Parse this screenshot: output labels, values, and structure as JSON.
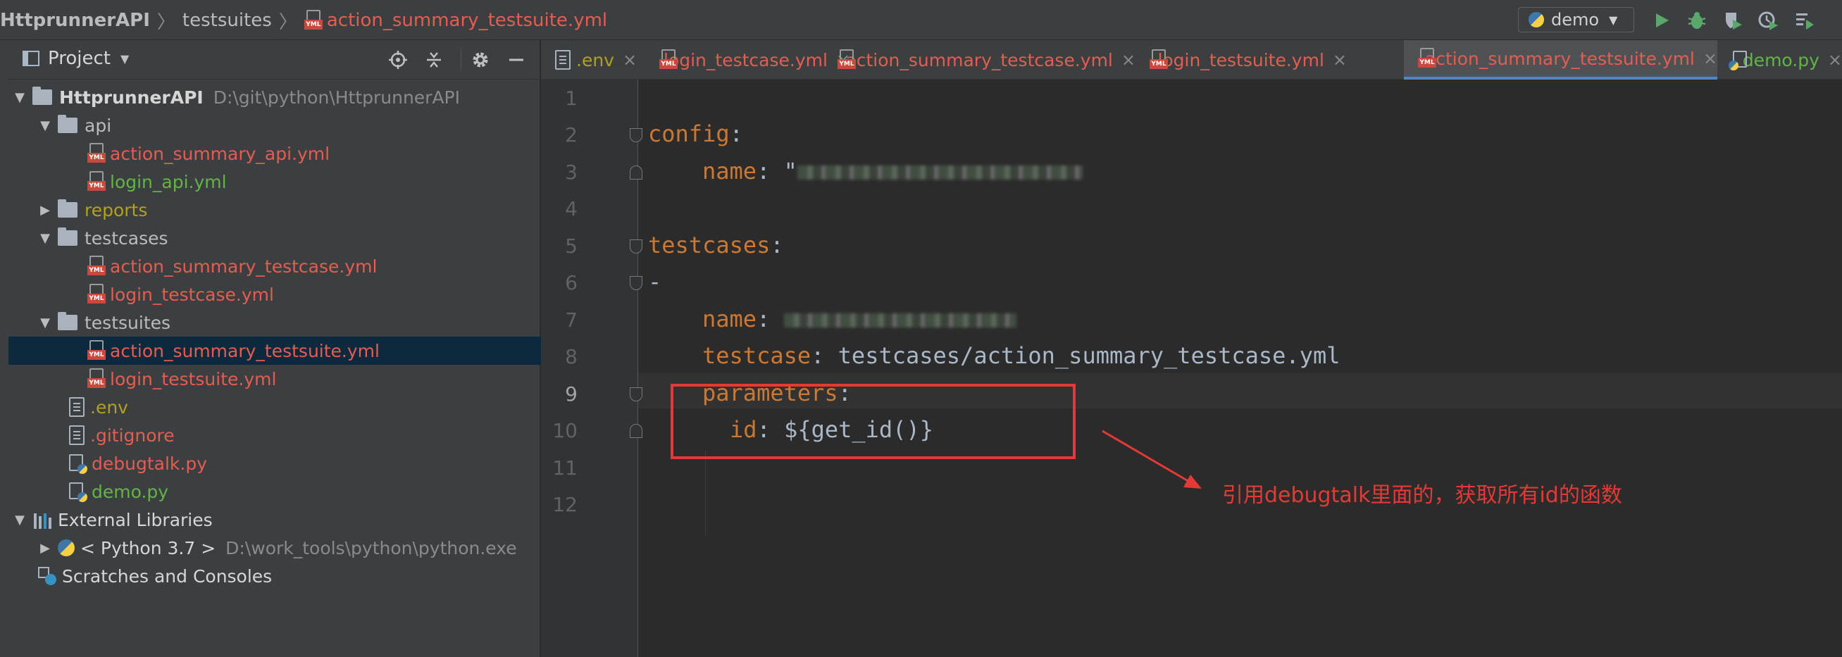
{
  "breadcrumb": {
    "project": "HttprunnerAPI",
    "folder": "testsuites",
    "file": "action_summary_testsuite.yml"
  },
  "toolbar": {
    "run_config": "demo",
    "icons": [
      "run-icon",
      "debug-icon",
      "coverage-icon",
      "profile-icon",
      "run-menu-icon"
    ]
  },
  "project_panel": {
    "title": "Project",
    "header_icons": [
      "locate-icon",
      "collapse-all-icon",
      "settings-icon",
      "hide-icon"
    ],
    "tree": [
      {
        "label": "HttprunnerAPI",
        "path": "D:\\git\\python\\HttprunnerAPI",
        "type": "root",
        "expanded": true
      },
      {
        "label": "api",
        "type": "folder",
        "expanded": true
      },
      {
        "label": "action_summary_api.yml",
        "type": "yml"
      },
      {
        "label": "login_api.yml",
        "type": "yml"
      },
      {
        "label": "reports",
        "type": "folder",
        "expanded": false
      },
      {
        "label": "testcases",
        "type": "folder",
        "expanded": true
      },
      {
        "label": "action_summary_testcase.yml",
        "type": "yml"
      },
      {
        "label": "login_testcase.yml",
        "type": "yml"
      },
      {
        "label": "testsuites",
        "type": "folder",
        "expanded": true
      },
      {
        "label": "action_summary_testsuite.yml",
        "type": "yml",
        "selected": true
      },
      {
        "label": "login_testsuite.yml",
        "type": "yml"
      },
      {
        "label": ".env",
        "type": "file"
      },
      {
        "label": ".gitignore",
        "type": "file"
      },
      {
        "label": "debugtalk.py",
        "type": "py"
      },
      {
        "label": "demo.py",
        "type": "py"
      },
      {
        "label": "External Libraries",
        "type": "lib",
        "expanded": true
      },
      {
        "label": "< Python 3.7 >",
        "path": "D:\\work_tools\\python\\python.exe",
        "type": "sdk"
      },
      {
        "label": "Scratches and Consoles",
        "type": "scratch"
      }
    ]
  },
  "tabs": [
    {
      "label": ".env",
      "close": "×"
    },
    {
      "label": "login_testcase.yml",
      "close": "×"
    },
    {
      "label": "action_summary_testcase.yml",
      "close": "×"
    },
    {
      "label": "login_testsuite.yml",
      "close": "×"
    },
    {
      "label": "action_summary_testsuite.yml",
      "close": "×",
      "active": true
    },
    {
      "label": "demo.py",
      "close": "×"
    }
  ],
  "editor": {
    "line_numbers": [
      "1",
      "2",
      "3",
      "4",
      "5",
      "6",
      "7",
      "8",
      "9",
      "10",
      "11",
      "12"
    ],
    "current_line": "9",
    "lines": {
      "l2_key": "config",
      "colon": ":",
      "l3_key": "name",
      "l3_quote": "\"",
      "l5_key": "testcases",
      "l6_dash": "-",
      "l7_key": "name",
      "l8_key": "testcase",
      "l8_val": "testcases/action_summary_testcase.yml",
      "l9_key": "parameters",
      "l10_key": "id",
      "l10_val": "${get_id()}"
    }
  },
  "annotation": "引用debugtalk里面的，获取所有id的函数",
  "colors": {
    "keyword": "#cc7832",
    "value": "#a9b7c6",
    "annotation": "#e53935",
    "selection": "#0d293e",
    "tab_underline": "#4a88c7"
  }
}
